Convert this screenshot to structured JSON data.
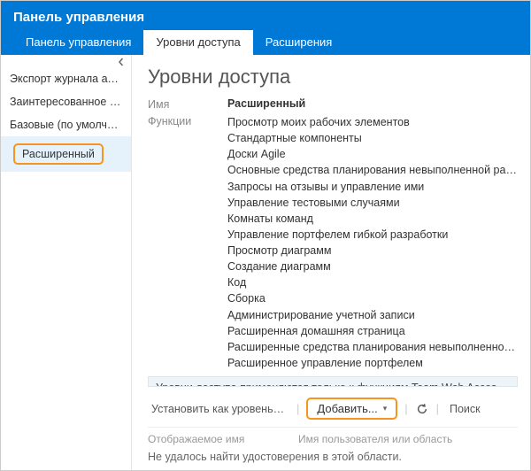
{
  "header": {
    "title": "Панель управления",
    "tabs": [
      {
        "label": "Панель управления"
      },
      {
        "label": "Уровни доступа"
      },
      {
        "label": "Расширения"
      }
    ]
  },
  "sidebar": {
    "items": [
      {
        "label": "Экспорт журнала аудита"
      },
      {
        "label": "Заинтересованное лицо"
      },
      {
        "label": "Базовые (по умолчанию)"
      },
      {
        "label": "Расширенный"
      }
    ]
  },
  "main": {
    "title": "Уровни доступа",
    "name_label": "Имя",
    "name_value": "Расширенный",
    "functions_label": "Функции",
    "features": [
      "Просмотр моих рабочих элементов",
      "Стандартные компоненты",
      "Доски Agile",
      "Основные средства планирования невыполненной раб...",
      "Запросы на отзывы и управление ими",
      "Управление тестовыми случаями",
      "Комнаты команд",
      "Управление портфелем гибкой разработки",
      "Просмотр диаграмм",
      "Создание диаграмм",
      "Код",
      "Сборка",
      "Администрирование учетной записи",
      "Расширенная домашняя страница",
      "Расширенные средства планирования невыполненной р...",
      "Расширенное управление портфелем"
    ],
    "info_banner": "Уровни доступа применяются только к функциям Team Web Access. До...",
    "toolbar": {
      "set_default": "Установить как уровень до...",
      "add": "Добавить...",
      "search": "Поиск"
    },
    "grid": {
      "col1": "Отображаемое имя",
      "col2": "Имя пользователя или область",
      "empty": "Не удалось найти удостоверения в этой области."
    }
  }
}
